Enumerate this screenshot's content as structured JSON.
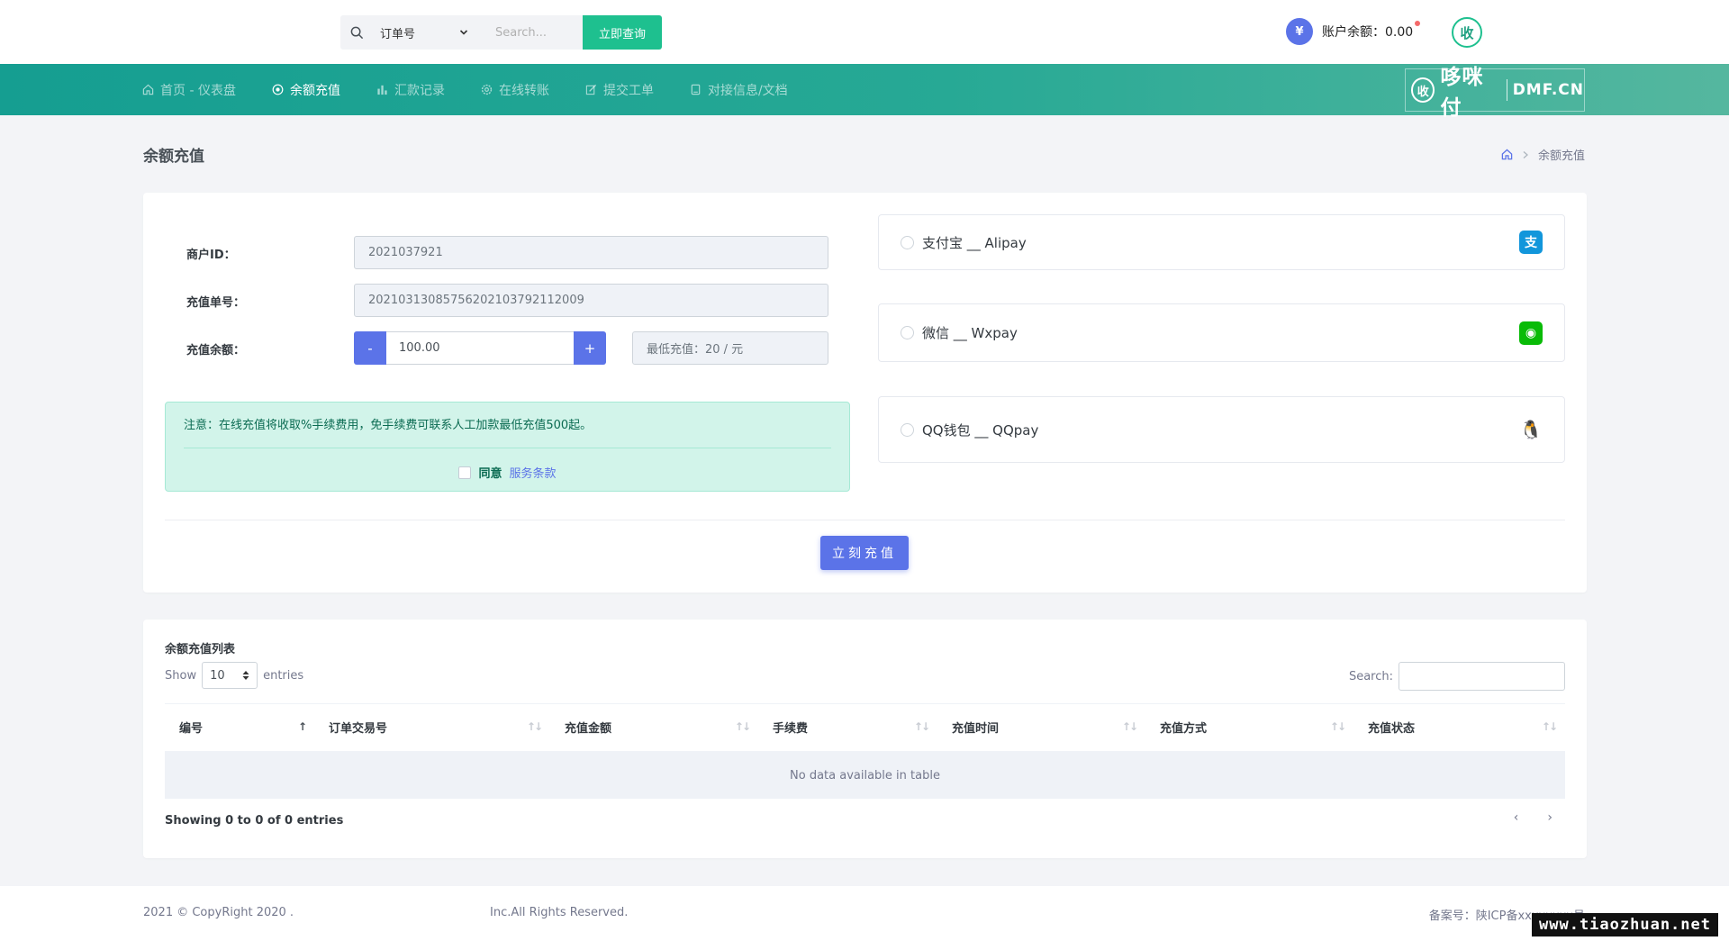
{
  "topbar": {
    "search_select": "订单号",
    "search_placeholder": "Search...",
    "search_button": "立即查询",
    "balance_label": "账户余额：0.00",
    "currency_symbol": "¥",
    "avatar_mark": "收"
  },
  "nav": {
    "items": [
      {
        "label": "首页 - 仪表盘",
        "icon": "home-icon"
      },
      {
        "label": "余额充值",
        "icon": "target-icon"
      },
      {
        "label": "汇款记录",
        "icon": "bar-chart-icon"
      },
      {
        "label": "在线转账",
        "icon": "gear-icon"
      },
      {
        "label": "提交工单",
        "icon": "edit-icon"
      },
      {
        "label": "对接信息/文档",
        "icon": "document-icon"
      }
    ],
    "logo_cn": "哆咪付",
    "logo_en": "DMF.CN",
    "logo_mark": "收"
  },
  "page": {
    "title": "余额充值",
    "breadcrumb": "余额充值"
  },
  "form": {
    "merchant_label": "商户ID：",
    "merchant_value": "2021037921",
    "order_label": "充值单号：",
    "order_value": "20210313085756202103792112009",
    "amount_label": "充值余额：",
    "amount_value": "100.00",
    "minus": "-",
    "plus": "+",
    "min_recharge": "最低充值：20 / 元",
    "notice": "注意：在线充值将收取%手续费用，免手续费可联系人工加款最低充值500起。",
    "agree_label": "同意",
    "terms_link": "服务条款",
    "submit": "立刻充值"
  },
  "payments": [
    {
      "label": "支付宝 __ Alipay",
      "icon": "alipay-icon",
      "glyph": "支"
    },
    {
      "label": "微信 __ Wxpay",
      "icon": "wechat-icon",
      "glyph": "◉"
    },
    {
      "label": "QQ钱包 __ QQpay",
      "icon": "qq-penguin-icon",
      "glyph": "🐧"
    }
  ],
  "table": {
    "title": "余额充值列表",
    "show": "Show",
    "page_size": "10",
    "entries": "entries",
    "search_label": "Search:",
    "columns": [
      "编号",
      "订单交易号",
      "充值金额",
      "手续费",
      "充值时间",
      "充值方式",
      "充值状态"
    ],
    "empty": "No data available in table",
    "showing": "Showing 0 to 0 of 0 entries",
    "prev": "‹",
    "next": "›"
  },
  "footer": {
    "left": "2021 © CopyRight 2020 .",
    "mid": "Inc.All Rights Reserved.",
    "right": "备案号：陕ICP备xxxxxxxx号"
  },
  "watermark": "www.tiaozhuan.net",
  "colors": {
    "primary": "#5b73e8",
    "success": "#1ec08f",
    "nav_start": "#159e91",
    "nav_end": "#55b79f"
  }
}
